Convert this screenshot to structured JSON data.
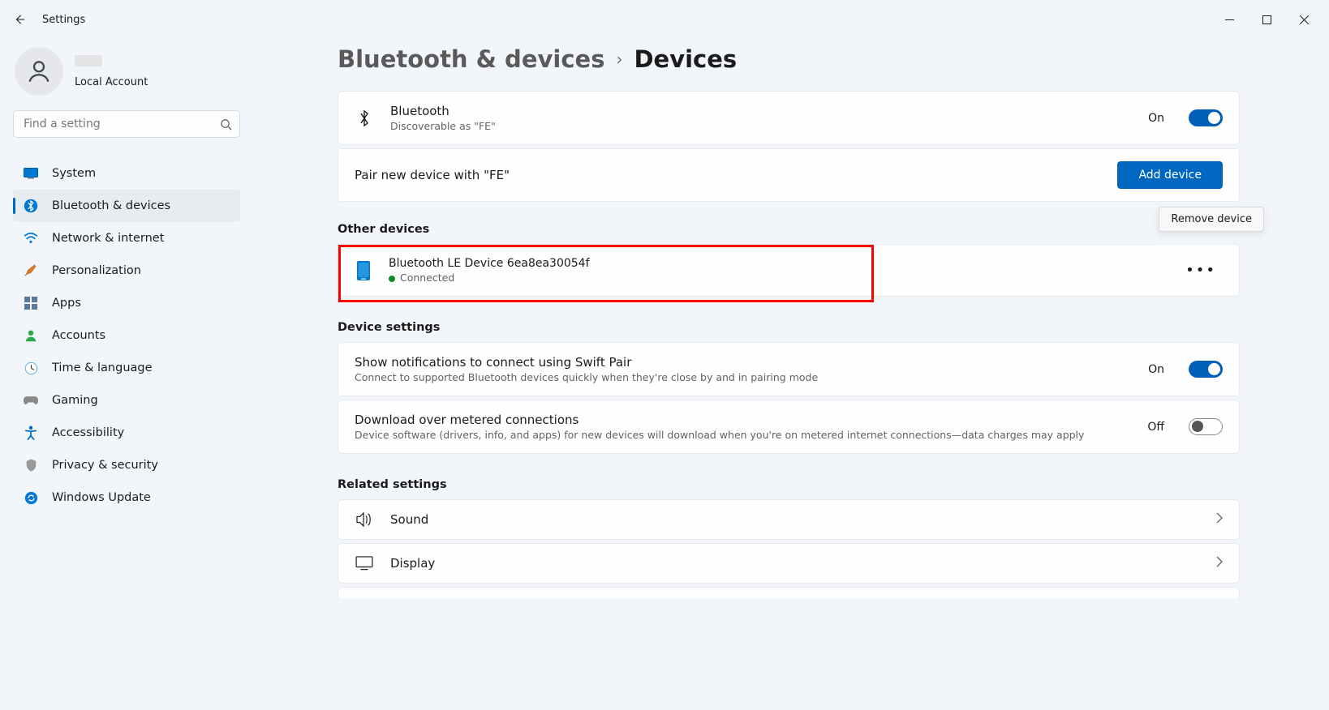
{
  "window": {
    "title": "Settings"
  },
  "profile": {
    "sub": "Local Account"
  },
  "search": {
    "placeholder": "Find a setting"
  },
  "nav": {
    "items": [
      {
        "label": "System"
      },
      {
        "label": "Bluetooth & devices"
      },
      {
        "label": "Network & internet"
      },
      {
        "label": "Personalization"
      },
      {
        "label": "Apps"
      },
      {
        "label": "Accounts"
      },
      {
        "label": "Time & language"
      },
      {
        "label": "Gaming"
      },
      {
        "label": "Accessibility"
      },
      {
        "label": "Privacy & security"
      },
      {
        "label": "Windows Update"
      }
    ]
  },
  "breadcrumb": {
    "parent": "Bluetooth & devices",
    "current": "Devices"
  },
  "bluetooth_card": {
    "title": "Bluetooth",
    "sub": "Discoverable as \"FE\"",
    "state": "On"
  },
  "pair_card": {
    "text": "Pair new device with \"FE\"",
    "button": "Add device"
  },
  "sections": {
    "other_devices": "Other devices",
    "device_settings": "Device settings",
    "related_settings": "Related settings"
  },
  "device": {
    "name": "Bluetooth LE Device 6ea8ea30054f",
    "status": "Connected",
    "tooltip": "Remove device"
  },
  "swift_pair": {
    "title": "Show notifications to connect using Swift Pair",
    "sub": "Connect to supported Bluetooth devices quickly when they're close by and in pairing mode",
    "state": "On"
  },
  "metered": {
    "title": "Download over metered connections",
    "sub": "Device software (drivers, info, and apps) for new devices will download when you're on metered internet connections—data charges may apply",
    "state": "Off"
  },
  "related": {
    "sound": "Sound",
    "display": "Display"
  }
}
